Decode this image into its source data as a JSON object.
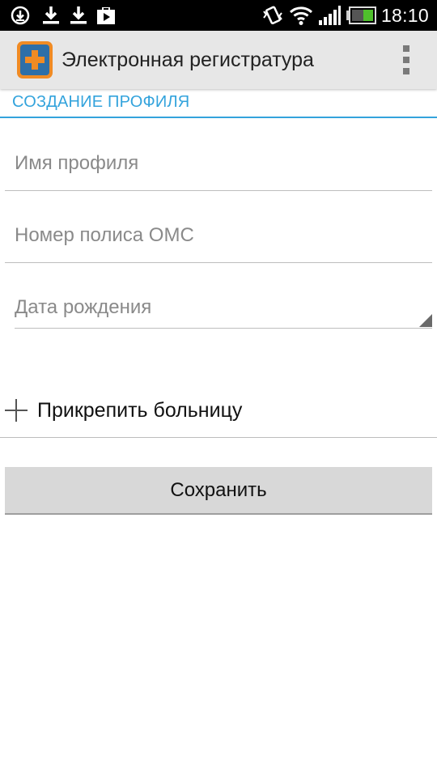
{
  "status_bar": {
    "time": "18:10",
    "icons_left": [
      "sync-download-icon",
      "download-icon",
      "download-icon",
      "play-store-icon"
    ],
    "icons_right": [
      "vibrate-icon",
      "wifi-icon",
      "signal-icon",
      "battery-icon"
    ]
  },
  "action_bar": {
    "title": "Электронная регистратура",
    "icon": "medical-plus-app-icon",
    "overflow_icon": "overflow-menu-icon"
  },
  "section": {
    "header": "СОЗДАНИЕ ПРОФИЛЯ"
  },
  "form": {
    "profile_name": {
      "value": "",
      "placeholder": "Имя профиля"
    },
    "policy_number": {
      "value": "",
      "placeholder": "Номер полиса ОМС"
    },
    "birth_date": {
      "placeholder": "Дата рождения"
    }
  },
  "attach": {
    "label": "Прикрепить больницу",
    "icon": "plus-icon"
  },
  "buttons": {
    "save_label": "Сохранить"
  },
  "colors": {
    "accent": "#33a3dc",
    "action_bar_bg": "#e7e7e7",
    "button_bg": "#d8d8d8",
    "status_bar_bg": "#000000"
  }
}
